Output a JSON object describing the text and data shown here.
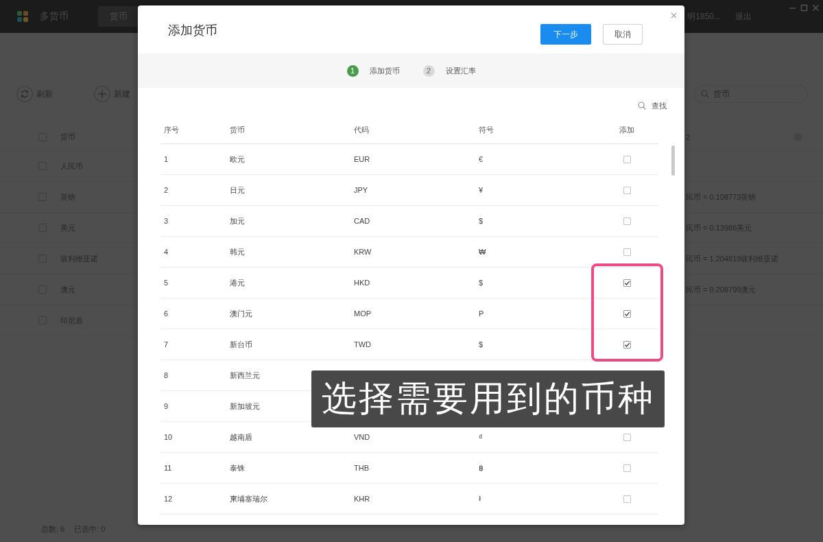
{
  "app": {
    "title": "多货币",
    "tabs": [
      {
        "label": "货币",
        "selected": true
      }
    ],
    "user": "明1850...",
    "logout": "退出"
  },
  "toolbar": {
    "buttons": [
      {
        "kind": "refresh",
        "label": "刷新"
      },
      {
        "kind": "new",
        "label": "新建"
      }
    ],
    "search": {
      "placeholder": "货币"
    }
  },
  "list": {
    "header": {
      "checked": false,
      "name": "货币",
      "rate": "2"
    },
    "rows": [
      {
        "checked": false,
        "name": "人民币"
      },
      {
        "checked": false,
        "name": "英镑",
        "rate": "民币 = 0.108773英镑"
      },
      {
        "checked": false,
        "name": "美元",
        "rate": "民币 = 0.13986美元"
      },
      {
        "checked": false,
        "name": "玻利维亚诺",
        "rate": "民币 = 1.204819玻利维亚诺"
      },
      {
        "checked": false,
        "name": "澳元",
        "rate": "民币 = 0.208799澳元"
      },
      {
        "checked": false,
        "name": "印尼盾"
      }
    ]
  },
  "footer": {
    "total": "总数: 6",
    "selected": "已选中: 0"
  },
  "dialog": {
    "title": "添加货币",
    "buttons": [
      {
        "kind": "primary",
        "label": "下一步"
      },
      {
        "kind": "secondary",
        "label": "取消"
      }
    ],
    "steps": [
      {
        "number": "1",
        "label": "添加货币",
        "selected": true
      },
      {
        "number": "2",
        "label": "设置汇率",
        "selected": false
      }
    ],
    "search_label": "查找",
    "columns": [
      "序号",
      "货币",
      "代码",
      "符号",
      "添加"
    ],
    "rows": [
      {
        "no": "1",
        "name": "欧元",
        "code": "EUR",
        "symbol": "€",
        "checked": false
      },
      {
        "no": "2",
        "name": "日元",
        "code": "JPY",
        "symbol": "¥",
        "checked": false
      },
      {
        "no": "3",
        "name": "加元",
        "code": "CAD",
        "symbol": "$",
        "checked": false
      },
      {
        "no": "4",
        "name": "韩元",
        "code": "KRW",
        "symbol": "₩",
        "checked": false
      },
      {
        "no": "5",
        "name": "港元",
        "code": "HKD",
        "symbol": "$",
        "checked": true
      },
      {
        "no": "6",
        "name": "澳门元",
        "code": "MOP",
        "symbol": "P",
        "checked": true
      },
      {
        "no": "7",
        "name": "新台币",
        "code": "TWD",
        "symbol": "$",
        "checked": true
      },
      {
        "no": "8",
        "name": "新西兰元"
      },
      {
        "no": "9",
        "name": "新加坡元"
      },
      {
        "no": "10",
        "name": "越南盾",
        "code": "VND",
        "symbol": "₫",
        "checked": false
      },
      {
        "no": "11",
        "name": "泰铢",
        "code": "THB",
        "symbol": "฿",
        "checked": false
      },
      {
        "no": "12",
        "name": "柬埔寨瑞尔",
        "code": "KHR",
        "symbol": "៛",
        "checked": false
      }
    ]
  },
  "caption": {
    "text": "选择需要用到的币种"
  }
}
